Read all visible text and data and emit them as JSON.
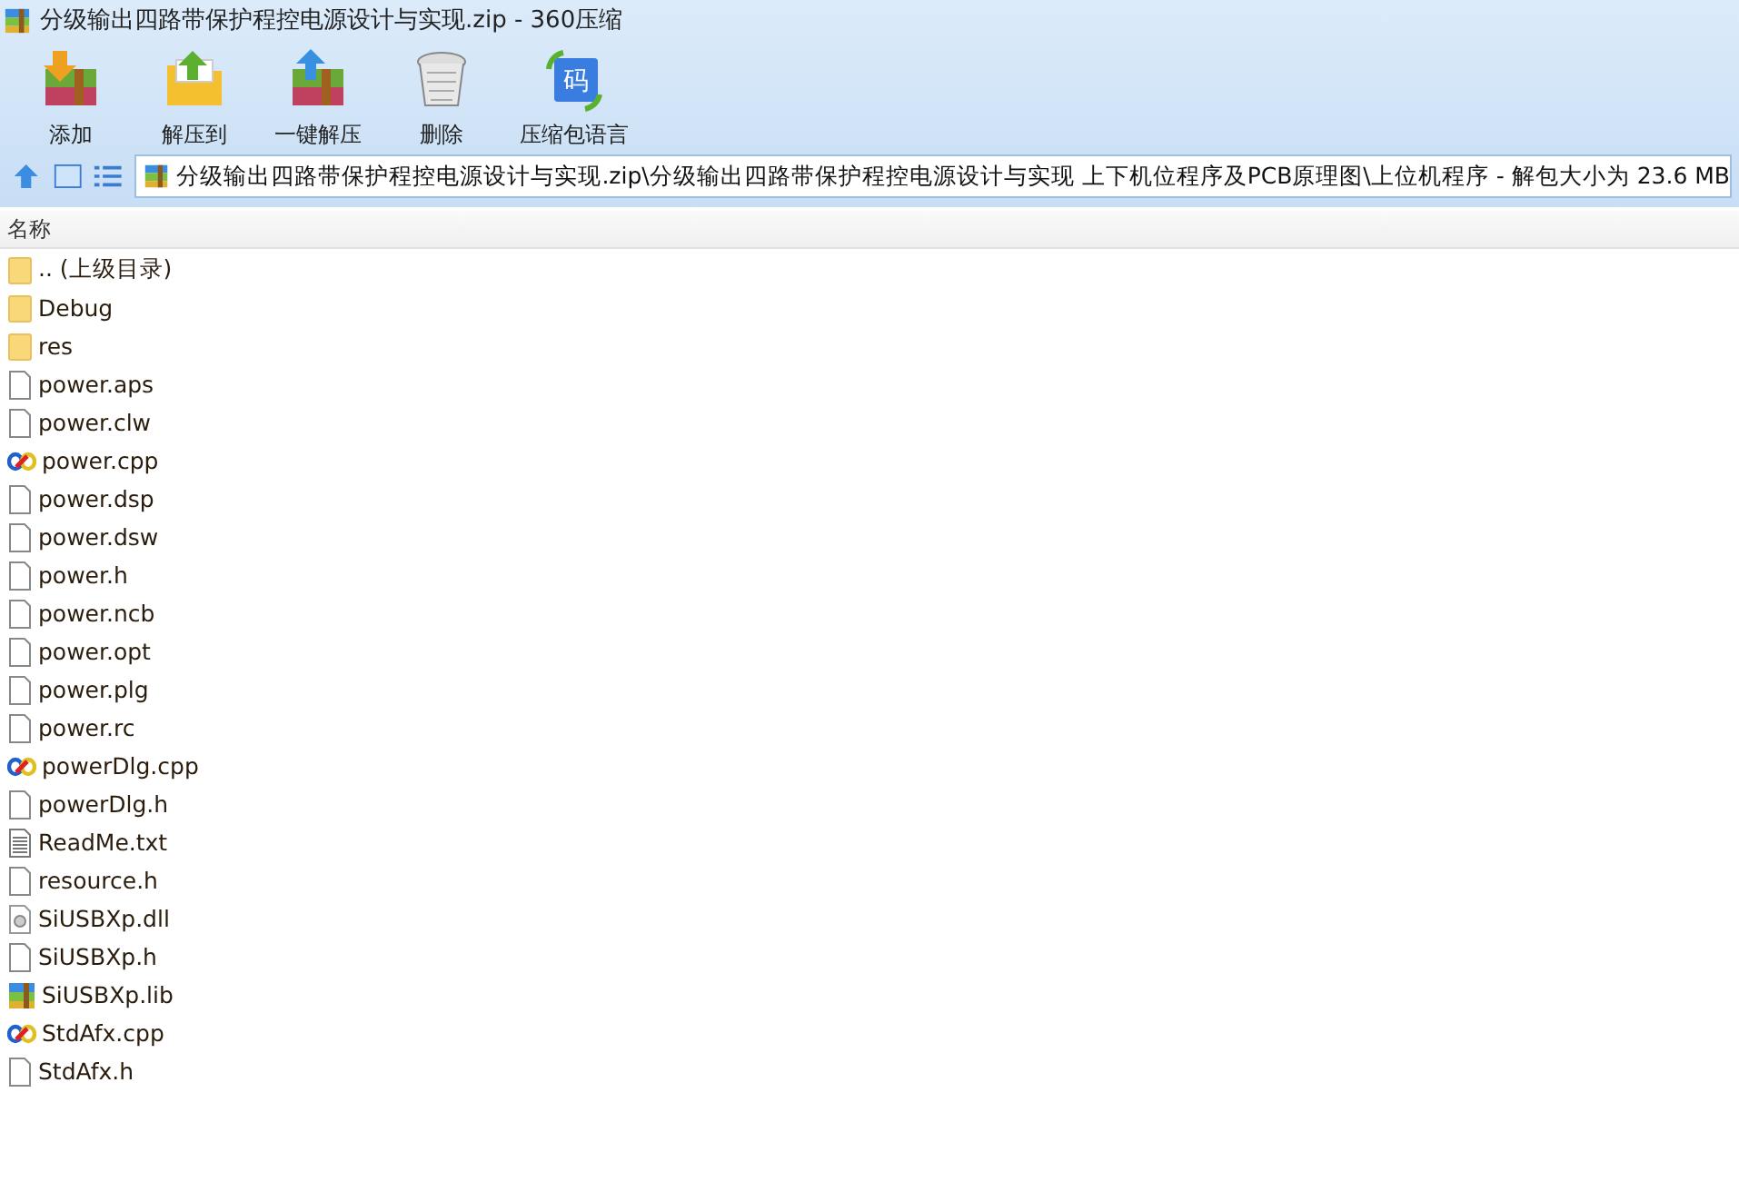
{
  "window": {
    "title": "分级输出四路带保护程控电源设计与实现.zip - 360压缩"
  },
  "toolbar": [
    {
      "label": "添加",
      "kind": "add"
    },
    {
      "label": "解压到",
      "kind": "extract"
    },
    {
      "label": "一键解压",
      "kind": "oneclick"
    },
    {
      "label": "删除",
      "kind": "delete"
    },
    {
      "label": "压缩包语言",
      "kind": "language",
      "glyph": "码"
    }
  ],
  "address_bar": {
    "path": "分级输出四路带保护程控电源设计与实现.zip\\分级输出四路带保护程控电源设计与实现 上下机位程序及PCB原理图\\上位机程序 - 解包大小为 23.6 MB"
  },
  "file_list": {
    "columns": [
      "名称"
    ],
    "rows": [
      {
        "name": ".. (上级目录)",
        "kind": "folder"
      },
      {
        "name": "Debug",
        "kind": "folder"
      },
      {
        "name": "res",
        "kind": "folder"
      },
      {
        "name": "power.aps",
        "kind": "file"
      },
      {
        "name": "power.clw",
        "kind": "file"
      },
      {
        "name": "power.cpp",
        "kind": "cpp"
      },
      {
        "name": "power.dsp",
        "kind": "file"
      },
      {
        "name": "power.dsw",
        "kind": "file"
      },
      {
        "name": "power.h",
        "kind": "file"
      },
      {
        "name": "power.ncb",
        "kind": "file"
      },
      {
        "name": "power.opt",
        "kind": "file"
      },
      {
        "name": "power.plg",
        "kind": "file"
      },
      {
        "name": "power.rc",
        "kind": "file"
      },
      {
        "name": "powerDlg.cpp",
        "kind": "cpp"
      },
      {
        "name": "powerDlg.h",
        "kind": "file"
      },
      {
        "name": "ReadMe.txt",
        "kind": "text"
      },
      {
        "name": "resource.h",
        "kind": "file"
      },
      {
        "name": "SiUSBXp.dll",
        "kind": "dll"
      },
      {
        "name": "SiUSBXp.h",
        "kind": "file"
      },
      {
        "name": "SiUSBXp.lib",
        "kind": "archive"
      },
      {
        "name": "StdAfx.cpp",
        "kind": "cpp"
      },
      {
        "name": "StdAfx.h",
        "kind": "file"
      }
    ]
  }
}
